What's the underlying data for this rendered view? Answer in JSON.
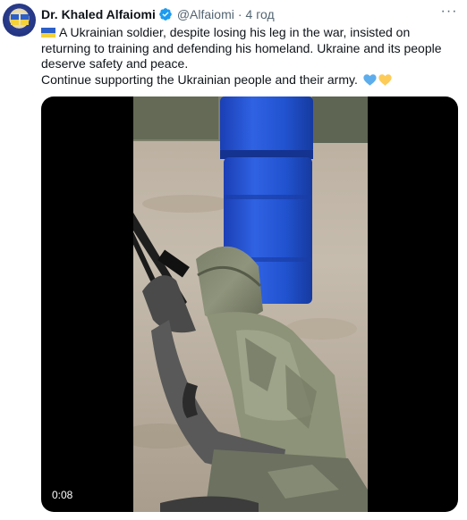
{
  "tweet": {
    "author_name": "Dr. Khaled Alfaiomi",
    "handle": "@Alfaiomi",
    "separator": "·",
    "time": "4 год",
    "text_line1": "A Ukrainian soldier, despite losing his leg in the war, insisted on returning to training and defending his homeland. Ukraine and its people deserve safety and peace.",
    "text_line2": "Continue supporting the Ukrainian people and their army.",
    "more_label": "···"
  },
  "icons": {
    "verified": "verified-badge-icon",
    "flag": "ukraine-flag-emoji",
    "blue_heart": "blue-heart-emoji",
    "yellow_heart": "yellow-heart-emoji",
    "more": "more-options-icon"
  },
  "media": {
    "type": "video",
    "duration": "0:08"
  },
  "colors": {
    "text": "#0f1419",
    "secondary": "#536471",
    "verified": "#1d9bf0",
    "flag_blue": "#2b5fc9",
    "flag_yellow": "#f3d23a"
  }
}
